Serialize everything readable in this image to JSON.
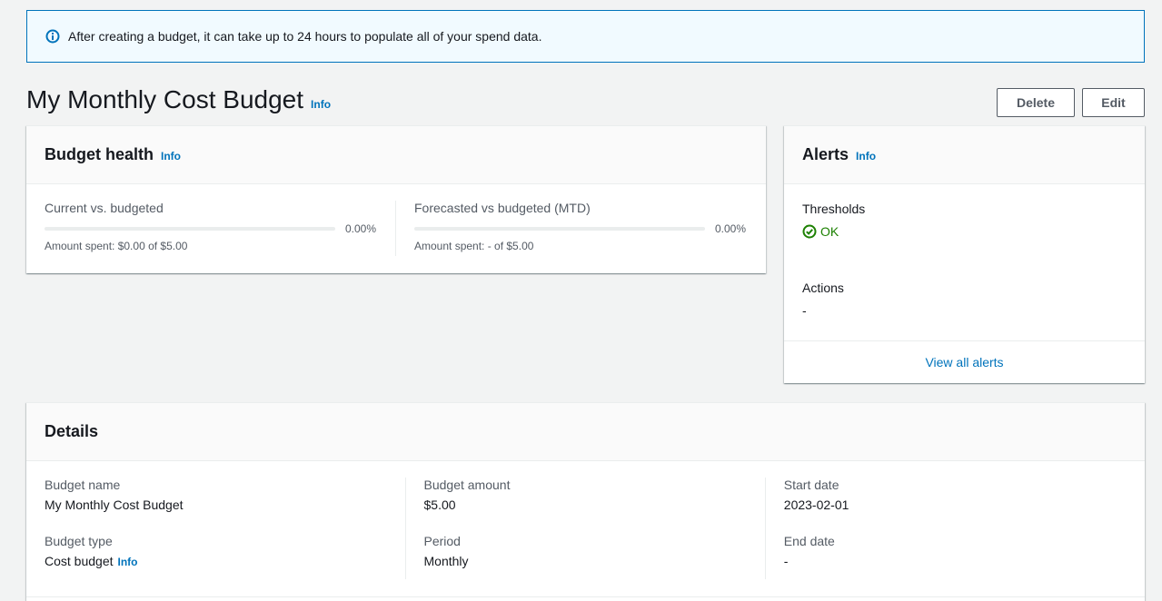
{
  "flash": {
    "icon": "info-icon",
    "text": "After creating a budget, it can take up to 24 hours to populate all of your spend data."
  },
  "header": {
    "title": "My Monthly Cost Budget",
    "info": "Info",
    "delete_label": "Delete",
    "edit_label": "Edit"
  },
  "health": {
    "title": "Budget health",
    "info": "Info",
    "current": {
      "label": "Current vs. budgeted",
      "percent": "0.00%",
      "progress": 0,
      "amount": "Amount spent: $0.00 of $5.00"
    },
    "forecast": {
      "label": "Forecasted vs budgeted (MTD)",
      "percent": "0.00%",
      "progress": 0,
      "amount": "Amount spent: - of $5.00"
    }
  },
  "alerts": {
    "title": "Alerts",
    "info": "Info",
    "thresholds_label": "Thresholds",
    "thresholds_status": "OK",
    "actions_label": "Actions",
    "actions_value": "-",
    "view_all": "View all alerts"
  },
  "details": {
    "title": "Details",
    "budget_name_label": "Budget name",
    "budget_name": "My Monthly Cost Budget",
    "budget_type_label": "Budget type",
    "budget_type": "Cost budget",
    "info": "Info",
    "budget_amount_label": "Budget amount",
    "budget_amount": "$5.00",
    "period_label": "Period",
    "period": "Monthly",
    "start_date_label": "Start date",
    "start_date": "2023-02-01",
    "end_date_label": "End date",
    "end_date": "-"
  },
  "colors": {
    "accent": "#0073bb",
    "success": "#1d8102",
    "background": "#f2f3f3"
  }
}
